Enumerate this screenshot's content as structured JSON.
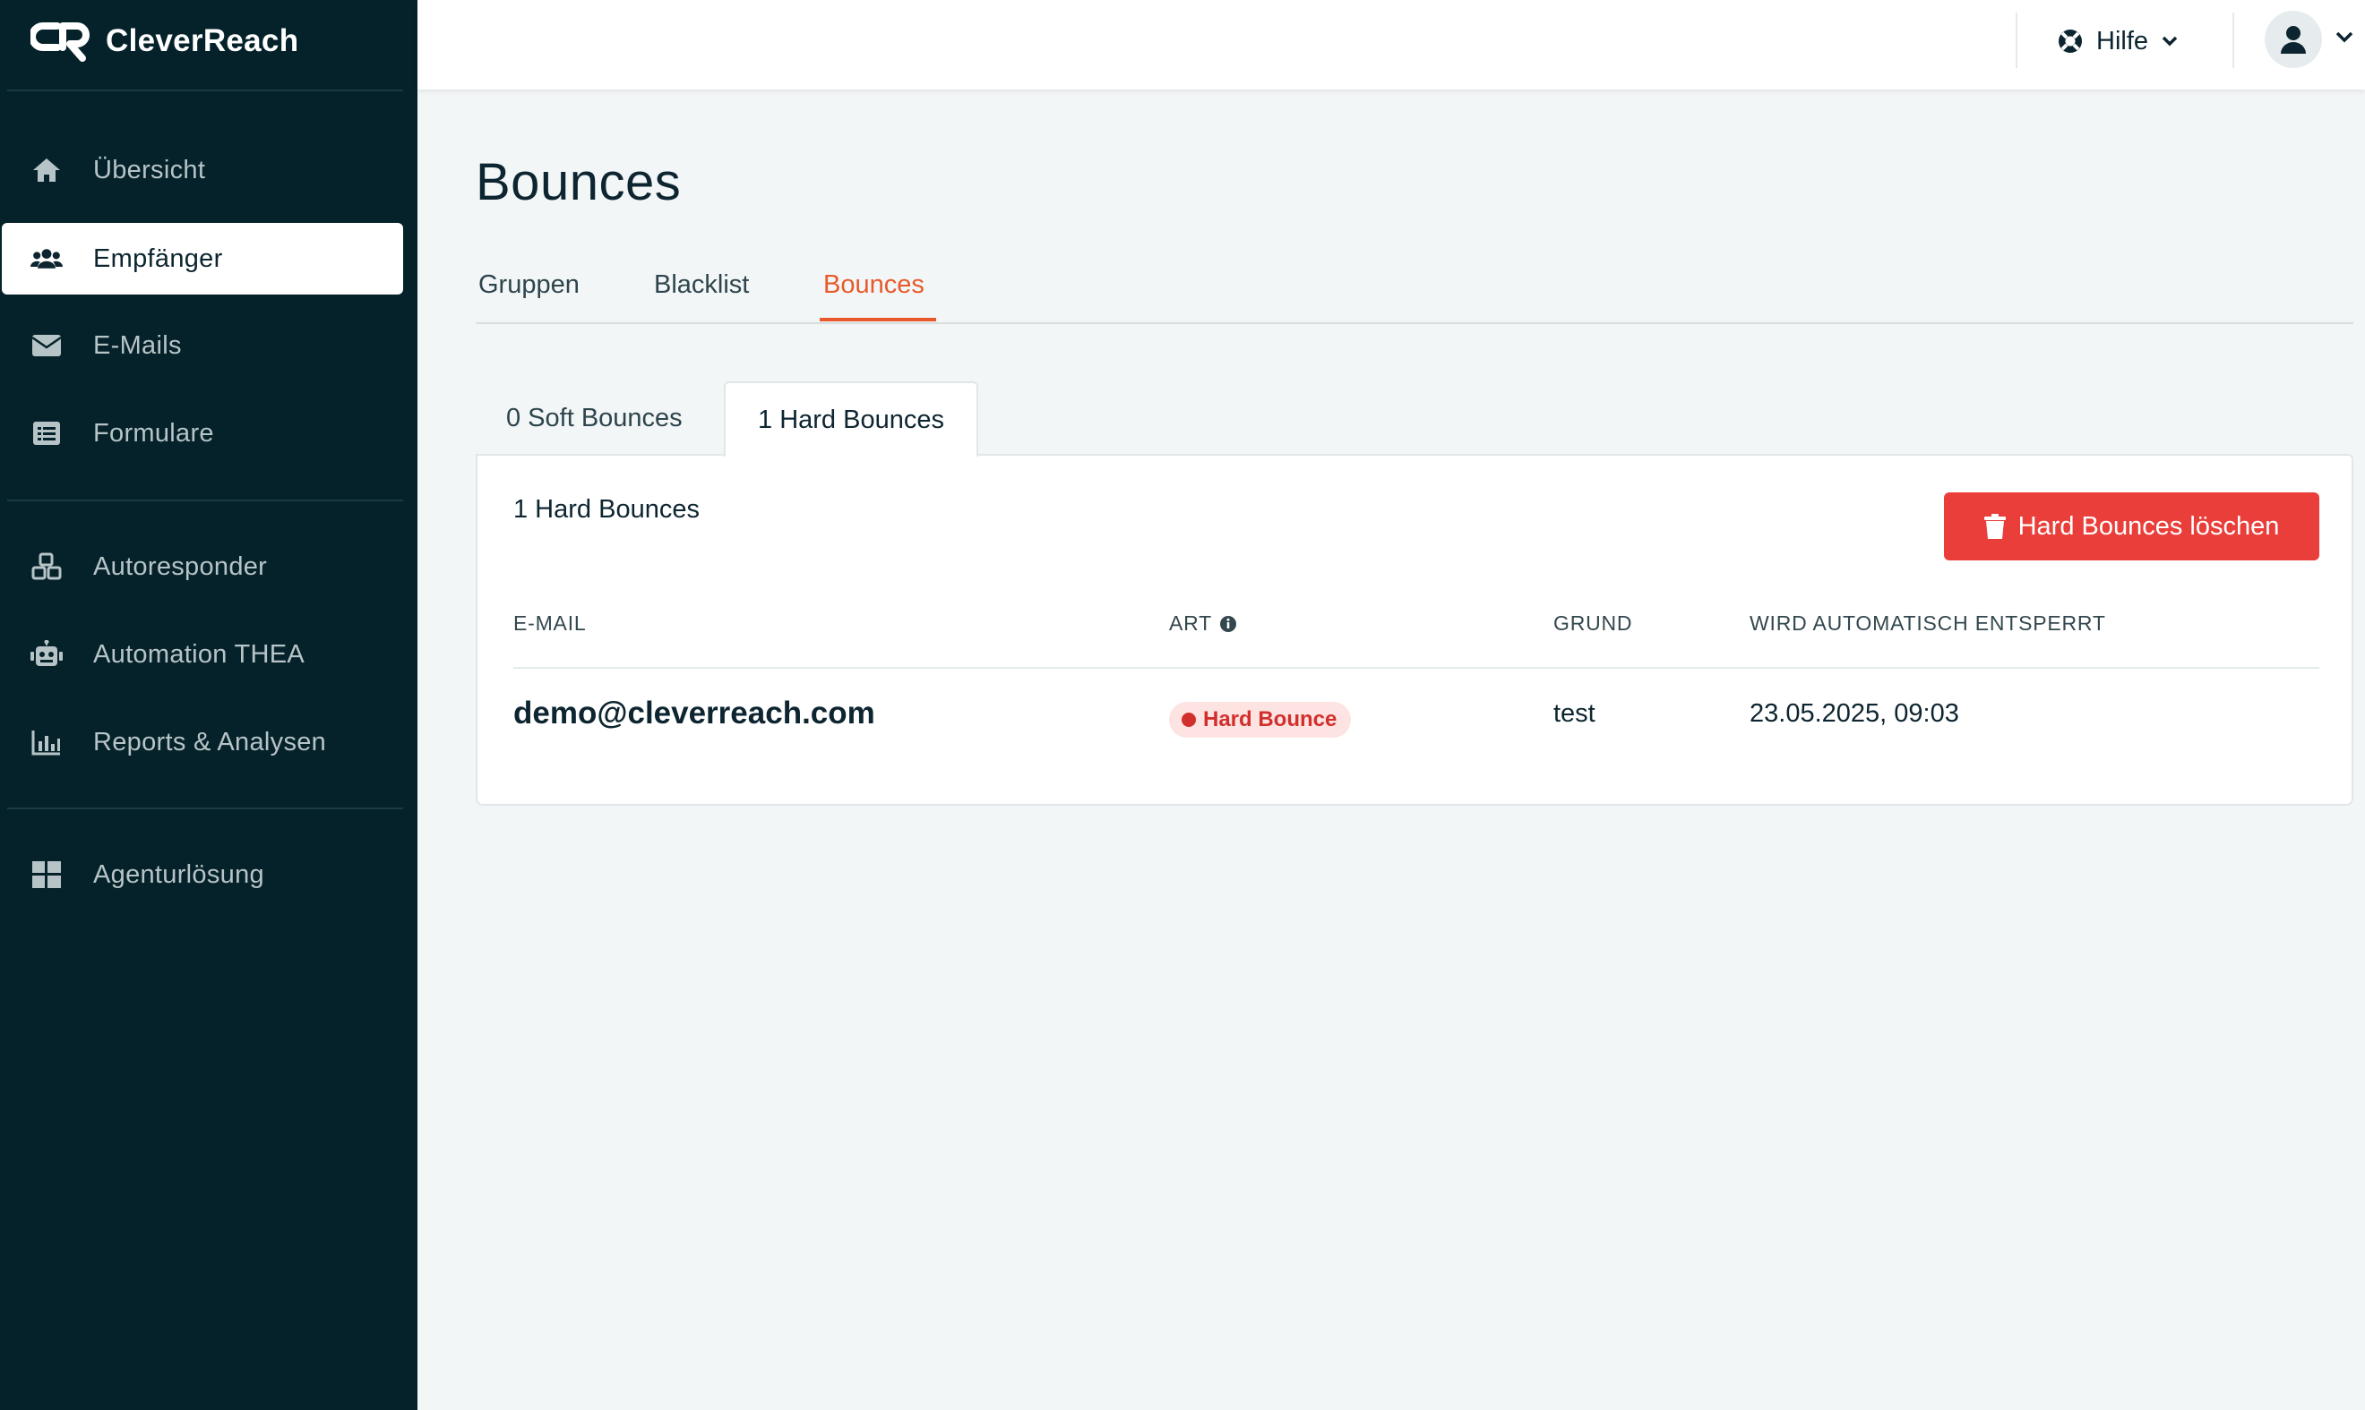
{
  "app": {
    "name": "CleverReach"
  },
  "sidebar": {
    "items": [
      {
        "label": "Übersicht",
        "icon": "home-icon"
      },
      {
        "label": "Empfänger",
        "icon": "users-icon",
        "active": true
      },
      {
        "label": "E-Mails",
        "icon": "envelope-icon"
      },
      {
        "label": "Formulare",
        "icon": "form-icon"
      },
      {
        "label": "Autoresponder",
        "icon": "cubes-icon"
      },
      {
        "label": "Automation THEA",
        "icon": "robot-icon"
      },
      {
        "label": "Reports & Analysen",
        "icon": "bar-chart-icon"
      },
      {
        "label": "Agenturlösung",
        "icon": "grid-icon"
      }
    ]
  },
  "header": {
    "help_label": "Hilfe"
  },
  "page": {
    "title": "Bounces",
    "tabs": [
      {
        "label": "Gruppen"
      },
      {
        "label": "Blacklist"
      },
      {
        "label": "Bounces",
        "active": true
      }
    ],
    "subtabs": [
      {
        "label": "0 Soft Bounces"
      },
      {
        "label": "1 Hard Bounces",
        "active": true
      }
    ]
  },
  "card": {
    "title": "1 Hard Bounces",
    "delete_button": "Hard Bounces löschen",
    "columns": [
      "E-MAIL",
      "ART",
      "GRUND",
      "WIRD AUTOMATISCH ENTSPERRT"
    ],
    "rows": [
      {
        "email": "demo@cleverreach.com",
        "type": "Hard Bounce",
        "reason": "test",
        "unlock": "23.05.2025, 09:03"
      }
    ]
  },
  "colors": {
    "sidebar": "#05222a",
    "accent": "#e85a2c",
    "danger": "#ea3e3a",
    "badge_bg": "#fde3e2",
    "background": "#f2f6f6"
  }
}
